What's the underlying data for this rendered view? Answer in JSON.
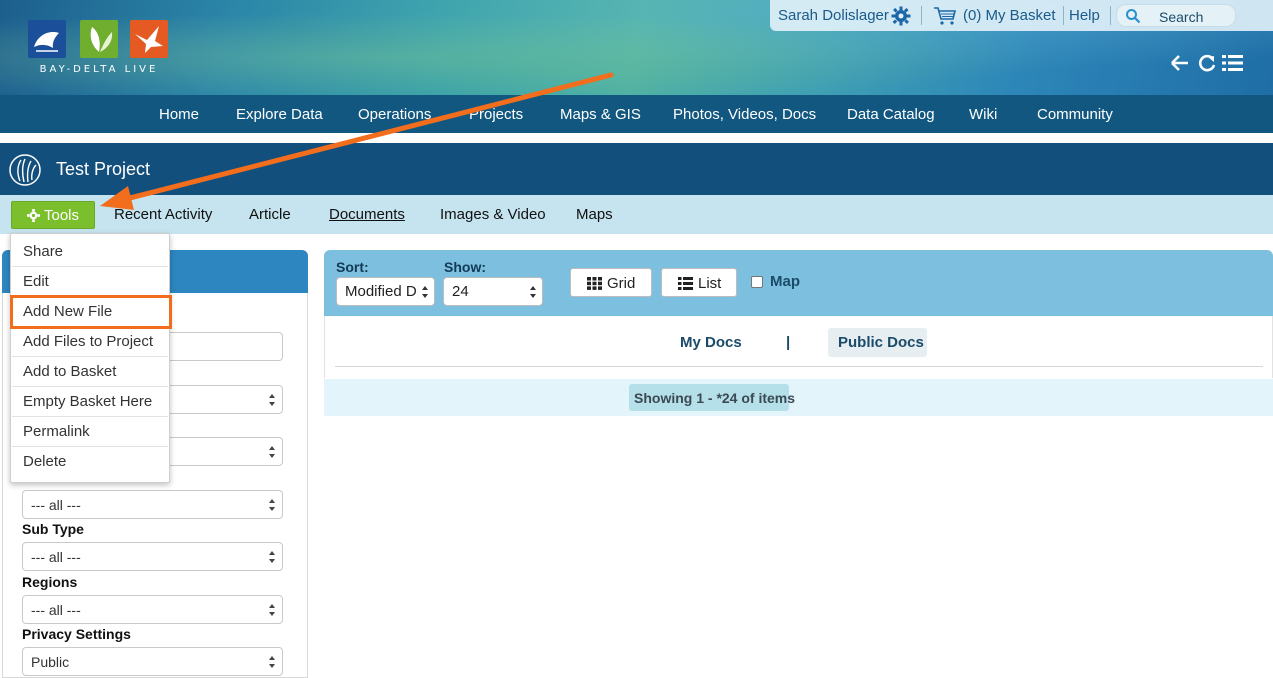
{
  "header": {
    "brand": "BAY-DELTA LIVE",
    "user_name": "Sarah Dolislager",
    "basket_label": "(0) My Basket",
    "help_label": "Help",
    "search_label": "Search"
  },
  "nav": {
    "items": [
      "Home",
      "Explore Data",
      "Operations",
      "Projects",
      "Maps & GIS",
      "Photos, Videos, Docs",
      "Data Catalog",
      "Wiki",
      "Community"
    ]
  },
  "project": {
    "title": "Test Project"
  },
  "subnav": {
    "tools_label": "Tools",
    "items": [
      "Recent Activity",
      "Article",
      "Documents",
      "Images & Video",
      "Maps"
    ],
    "active": "Documents"
  },
  "tools_menu": {
    "items": [
      "Share",
      "Edit",
      "Add New File",
      "Add Files to Project",
      "Add to Basket",
      "Empty Basket Here",
      "Permalink",
      "Delete"
    ],
    "highlighted": "Add New File"
  },
  "filters": {
    "type_value": "--- all ---",
    "sub_type_label": "Sub Type",
    "sub_type_value": "--- all ---",
    "regions_label": "Regions",
    "regions_value": "--- all ---",
    "privacy_label": "Privacy Settings",
    "privacy_value": "Public"
  },
  "toolbar": {
    "sort_label": "Sort:",
    "sort_value": "Modified D",
    "show_label": "Show:",
    "show_value": "24",
    "grid_label": "Grid",
    "list_label": "List",
    "map_label": "Map"
  },
  "docs": {
    "my_docs": "My Docs",
    "separator": "|",
    "public_docs": "Public Docs",
    "showing": "Showing 1 - *24 of items"
  },
  "colors": {
    "nav_bg": "#12577f",
    "tools_green": "#7cbf2c",
    "highlight_orange": "#f26d1c"
  }
}
